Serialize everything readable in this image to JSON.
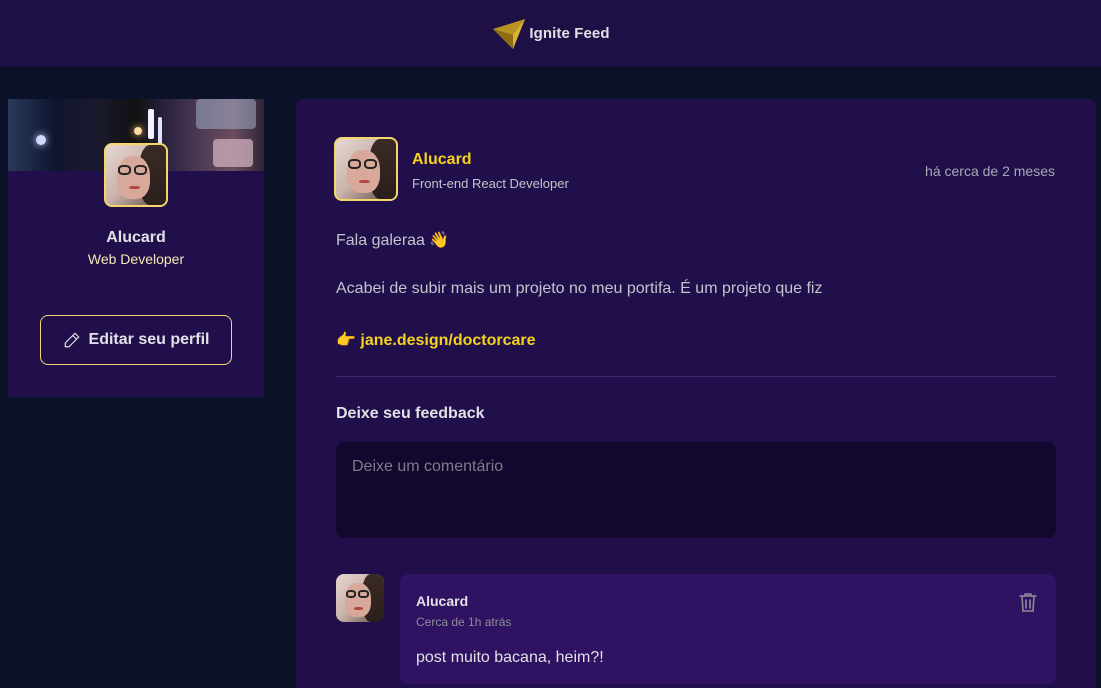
{
  "header": {
    "title": "Ignite Feed",
    "logo_icon": "ignite-logo-icon"
  },
  "sidebar": {
    "name": "Alucard",
    "role": "Web Developer",
    "edit_label": "Editar seu perfil"
  },
  "post": {
    "author": {
      "name": "Alucard",
      "role": "Front-end React Developer"
    },
    "time": "há cerca de 2 meses",
    "content": {
      "p1": "Fala galeraa 👋",
      "p2": "Acabei de subir mais um projeto no meu portifa. É um projeto que fiz",
      "p3": "👉 jane.design/doctorcare"
    },
    "feedback_title": "Deixe seu feedback",
    "comment_placeholder": "Deixe um comentário",
    "comments": [
      {
        "author": "Alucard",
        "time": "Cerca de 1h atrás",
        "text": "post muito bacana, heim?!"
      }
    ]
  },
  "colors": {
    "accent": "#f5d21d",
    "header_bg": "#1e0f45",
    "card_bg": "#200f4a",
    "page_bg": "#0b1128"
  }
}
